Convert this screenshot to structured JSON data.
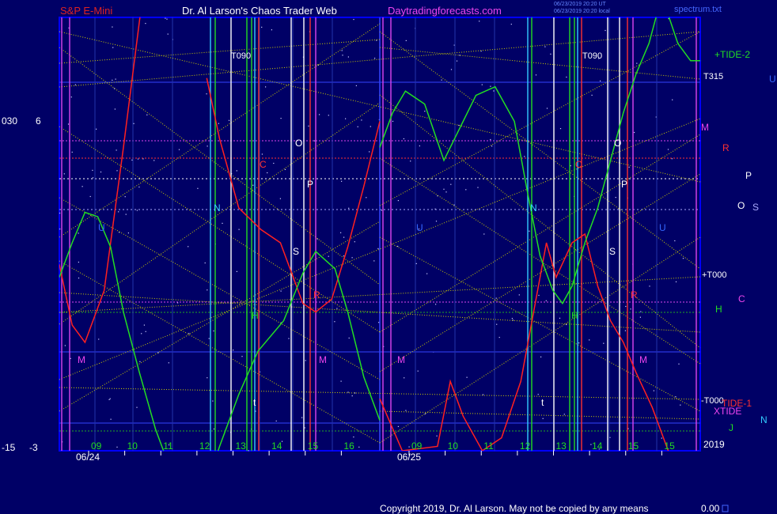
{
  "header": {
    "instrument": "S&P E-Mini",
    "site": "Dr. Al Larson's Chaos Trader Web",
    "url": "Daytradingforecasts.com",
    "timestamp1": "06/23/2019 20:20 UT",
    "timestamp2": "06/23/2019 20:20 local",
    "filename": "spectrum.txt"
  },
  "footer": {
    "copyright": "Copyright 2019, Dr. Al Larson. May not be copied by any means",
    "readout": "0.00"
  },
  "left_axis": {
    "top_labels": [
      "030",
      "6"
    ],
    "bottom_labels": [
      "-15",
      "-3"
    ]
  },
  "colors": {
    "background": "#000066",
    "plot_border": "#0000ff",
    "red_curve": "#ff2020",
    "green_curve": "#22dd22",
    "magenta_curve": "#dd44ee",
    "yellow_lines": "#cccc00",
    "title_red": "#dd2222",
    "title_white": "#ffffff",
    "title_magenta": "#ee44ee"
  },
  "chart_data": {
    "type": "line",
    "panels": [
      {
        "date_label": "06/24",
        "hour_ticks": [
          "09",
          "10",
          "11",
          "12",
          "13",
          "14",
          "15",
          "16"
        ],
        "t090_label": "T090",
        "planet_labels": [
          {
            "text": "O",
            "color": "#ffffff"
          },
          {
            "text": "P",
            "color": "#ffffff"
          },
          {
            "text": "C",
            "color": "#ff3030"
          },
          {
            "text": "N",
            "color": "#33ccff"
          },
          {
            "text": "U",
            "color": "#3366ff"
          },
          {
            "text": "S",
            "color": "#ffffff"
          },
          {
            "text": "R",
            "color": "#ff3030"
          },
          {
            "text": "H",
            "color": "#22dd22"
          },
          {
            "text": "M",
            "color": "#ee44ee"
          },
          {
            "text": "M",
            "color": "#ee44ee"
          },
          {
            "text": "t",
            "color": "#ffffff"
          }
        ],
        "series": [
          {
            "name": "",
            "color": "#ff2020",
            "points": [
              [
                0.0,
                0.57
              ],
              [
                0.04,
                0.71
              ],
              [
                0.08,
                0.75
              ],
              [
                0.14,
                0.63
              ],
              [
                0.2,
                0.3
              ],
              [
                0.26,
                -0.05
              ]
            ]
          },
          {
            "name": "",
            "color": "#ff2020",
            "points": [
              [
                0.46,
                0.14
              ],
              [
                0.5,
                0.28
              ],
              [
                0.56,
                0.44
              ],
              [
                0.63,
                0.49
              ],
              [
                0.69,
                0.52
              ],
              [
                0.76,
                0.66
              ],
              [
                0.8,
                0.68
              ],
              [
                0.85,
                0.65
              ],
              [
                0.9,
                0.53
              ],
              [
                0.95,
                0.39
              ],
              [
                1.0,
                0.24
              ]
            ]
          },
          {
            "name": "",
            "color": "#22dd22",
            "points": [
              [
                0.0,
                0.6
              ],
              [
                0.04,
                0.52
              ],
              [
                0.08,
                0.45
              ],
              [
                0.12,
                0.46
              ],
              [
                0.16,
                0.53
              ],
              [
                0.2,
                0.68
              ],
              [
                0.25,
                0.82
              ],
              [
                0.3,
                0.95
              ],
              [
                0.35,
                1.05
              ],
              [
                0.4,
                1.15
              ],
              [
                0.45,
                1.1
              ],
              [
                0.5,
                0.99
              ],
              [
                0.56,
                0.87
              ],
              [
                0.62,
                0.77
              ],
              [
                0.7,
                0.7
              ],
              [
                0.76,
                0.59
              ],
              [
                0.8,
                0.54
              ],
              [
                0.86,
                0.58
              ],
              [
                0.9,
                0.68
              ],
              [
                0.95,
                0.83
              ],
              [
                1.0,
                0.93
              ]
            ]
          },
          {
            "name": "",
            "color": "#dd44ee",
            "points": [
              [
                0.0,
                1.1
              ],
              [
                0.1,
                1.06
              ],
              [
                0.2,
                1.15
              ],
              [
                0.3,
                1.09
              ],
              [
                0.4,
                1.13
              ],
              [
                0.5,
                1.08
              ],
              [
                0.6,
                1.12
              ],
              [
                0.7,
                1.07
              ],
              [
                0.8,
                1.11
              ],
              [
                0.9,
                1.08
              ],
              [
                1.0,
                1.06
              ]
            ]
          }
        ]
      },
      {
        "date_label": "06/25",
        "hour_ticks": [
          "09",
          "10",
          "11",
          "12",
          "13",
          "14",
          "15",
          "15"
        ],
        "t090_label": "T090",
        "planet_labels": [
          {
            "text": "O",
            "color": "#ffffff"
          },
          {
            "text": "P",
            "color": "#ffffff"
          },
          {
            "text": "C",
            "color": "#ff3030"
          },
          {
            "text": "N",
            "color": "#33ccff"
          },
          {
            "text": "U",
            "color": "#3366ff"
          },
          {
            "text": "U",
            "color": "#3366ff"
          },
          {
            "text": "S",
            "color": "#ffffff"
          },
          {
            "text": "R",
            "color": "#ff3030"
          },
          {
            "text": "H",
            "color": "#22dd22"
          },
          {
            "text": "M",
            "color": "#ee44ee"
          },
          {
            "text": "M",
            "color": "#ee44ee"
          },
          {
            "text": "t",
            "color": "#ffffff"
          }
        ],
        "series": [
          {
            "name": "",
            "color": "#ff2020",
            "points": [
              [
                0.0,
                0.88
              ],
              [
                0.07,
                1.0
              ],
              [
                0.18,
                0.99
              ],
              [
                0.22,
                0.84
              ],
              [
                0.26,
                0.92
              ],
              [
                0.32,
                1.0
              ],
              [
                0.38,
                0.97
              ],
              [
                0.44,
                0.84
              ],
              [
                0.48,
                0.68
              ],
              [
                0.52,
                0.52
              ],
              [
                0.55,
                0.6
              ],
              [
                0.6,
                0.52
              ],
              [
                0.64,
                0.5
              ],
              [
                0.68,
                0.62
              ],
              [
                0.72,
                0.7
              ],
              [
                0.76,
                0.75
              ],
              [
                0.8,
                0.82
              ],
              [
                0.85,
                0.9
              ],
              [
                0.9,
                1.0
              ],
              [
                0.96,
                1.1
              ],
              [
                1.0,
                1.2
              ]
            ]
          },
          {
            "name": "",
            "color": "#22dd22",
            "points": [
              [
                0.0,
                0.3
              ],
              [
                0.04,
                0.22
              ],
              [
                0.08,
                0.17
              ],
              [
                0.14,
                0.2
              ],
              [
                0.2,
                0.33
              ],
              [
                0.26,
                0.24
              ],
              [
                0.3,
                0.18
              ],
              [
                0.36,
                0.16
              ],
              [
                0.42,
                0.24
              ],
              [
                0.46,
                0.4
              ],
              [
                0.5,
                0.55
              ],
              [
                0.54,
                0.63
              ],
              [
                0.57,
                0.66
              ],
              [
                0.6,
                0.62
              ],
              [
                0.64,
                0.52
              ],
              [
                0.68,
                0.44
              ],
              [
                0.72,
                0.33
              ],
              [
                0.76,
                0.22
              ],
              [
                0.8,
                0.13
              ],
              [
                0.84,
                0.06
              ],
              [
                0.88,
                -0.05
              ],
              [
                0.93,
                0.06
              ],
              [
                0.97,
                0.1
              ],
              [
                1.0,
                0.1
              ]
            ]
          },
          {
            "name": "",
            "color": "#dd44ee",
            "points": [
              [
                0.0,
                1.07
              ],
              [
                0.1,
                1.12
              ],
              [
                0.2,
                1.08
              ],
              [
                0.3,
                1.14
              ],
              [
                0.4,
                1.09
              ],
              [
                0.5,
                1.12
              ],
              [
                0.6,
                1.06
              ],
              [
                0.7,
                1.1
              ],
              [
                0.8,
                1.13
              ],
              [
                0.9,
                1.08
              ],
              [
                1.0,
                1.1
              ]
            ]
          }
        ]
      }
    ]
  },
  "right_labels": {
    "tide2": "+TIDE-2",
    "t315": "T315",
    "m": "M",
    "r": "R",
    "t000_plus": "+T000",
    "h": "H",
    "t000_minus": "-T000",
    "tide1": "TIDE-1",
    "xtide": "XTIDE",
    "j": "J",
    "year": "2019",
    "far_u": "U",
    "far_p": "P",
    "far_o": "O",
    "far_s": "S",
    "far_c": "C",
    "far_n": "N"
  }
}
